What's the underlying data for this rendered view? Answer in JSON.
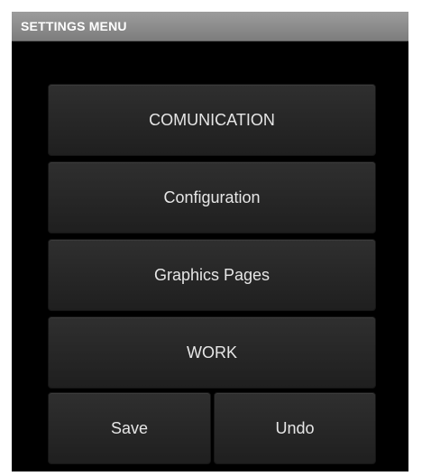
{
  "window": {
    "title": "SETTINGS MENU"
  },
  "menu": {
    "items": [
      {
        "label": "COMUNICATION"
      },
      {
        "label": "Configuration"
      },
      {
        "label": "Graphics Pages"
      },
      {
        "label": "WORK"
      }
    ]
  },
  "actions": {
    "save_label": "Save",
    "undo_label": "Undo"
  },
  "colors": {
    "background": "#000000",
    "titlebar": "#8a8a8a",
    "button": "#262626",
    "text": "#e6e6e6"
  }
}
